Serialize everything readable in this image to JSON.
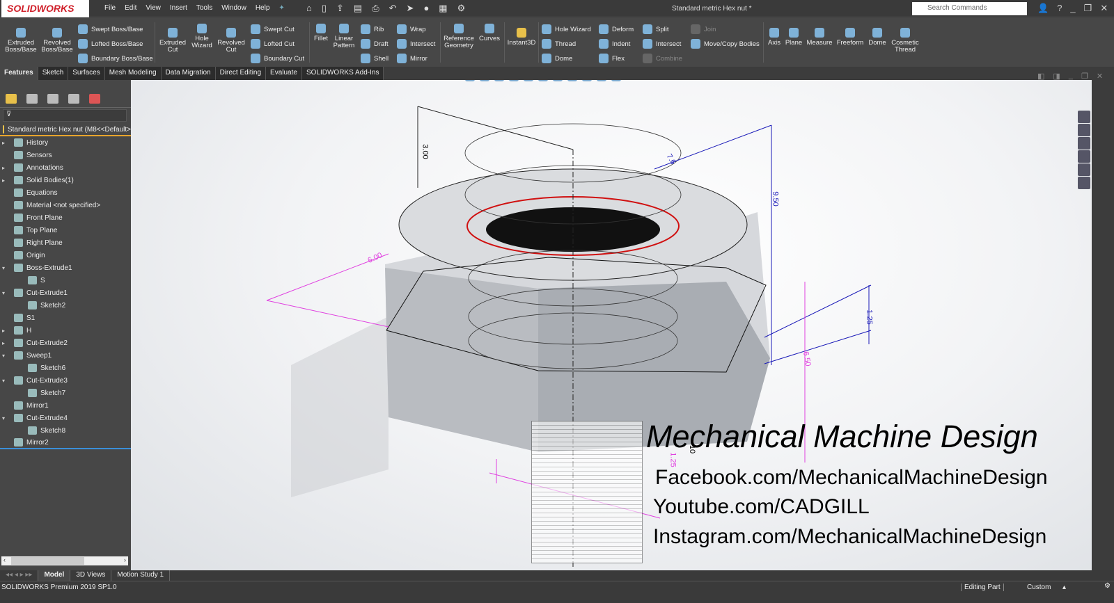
{
  "app": {
    "logo": "SOLIDWORKS",
    "title": "Standard metric Hex nut *",
    "search_placeholder": "Search Commands"
  },
  "menu": [
    "File",
    "Edit",
    "View",
    "Insert",
    "Tools",
    "Window",
    "Help"
  ],
  "ribbon": {
    "extruded_boss": "Extruded Boss/Base",
    "revolved_boss": "Revolved Boss/Base",
    "swept_boss": "Swept Boss/Base",
    "lofted_boss": "Lofted Boss/Base",
    "boundary_boss": "Boundary Boss/Base",
    "extruded_cut": "Extruded Cut",
    "hole_wizard": "Hole Wizard",
    "revolved_cut": "Revolved Cut",
    "swept_cut": "Swept Cut",
    "lofted_cut": "Lofted Cut",
    "boundary_cut": "Boundary Cut",
    "fillet": "Fillet",
    "linear_pattern": "Linear Pattern",
    "rib": "Rib",
    "draft": "Draft",
    "shell": "Shell",
    "wrap": "Wrap",
    "intersect": "Intersect",
    "mirror": "Mirror",
    "reference_geometry": "Reference Geometry",
    "curves": "Curves",
    "instant3d": "Instant3D",
    "hole_wizard2": "Hole Wizard",
    "thread": "Thread",
    "dome": "Dome",
    "deform": "Deform",
    "indent": "Indent",
    "flex": "Flex",
    "split": "Split",
    "intersect2": "Intersect",
    "combine": "Combine",
    "join": "Join",
    "move_copy": "Move/Copy Bodies",
    "axis": "Axis",
    "plane": "Plane",
    "measure": "Measure",
    "freeform": "Freeform",
    "dome2": "Dome",
    "cosmetic_thread": "Cosmetic Thread"
  },
  "tabs": [
    "Features",
    "Sketch",
    "Surfaces",
    "Mesh Modeling",
    "Data Migration",
    "Direct Editing",
    "Evaluate",
    "SOLIDWORKS Add-Ins"
  ],
  "tree": {
    "root": "Standard metric Hex nut  (M8<<Default>",
    "items": [
      {
        "label": "History",
        "arrow": "▸",
        "indent": 0
      },
      {
        "label": "Sensors",
        "arrow": "",
        "indent": 0
      },
      {
        "label": "Annotations",
        "arrow": "▸",
        "indent": 0
      },
      {
        "label": "Solid Bodies(1)",
        "arrow": "▸",
        "indent": 0
      },
      {
        "label": "Equations",
        "arrow": "",
        "indent": 0
      },
      {
        "label": "Material <not specified>",
        "arrow": "",
        "indent": 0
      },
      {
        "label": "Front Plane",
        "arrow": "",
        "indent": 0
      },
      {
        "label": "Top Plane",
        "arrow": "",
        "indent": 0
      },
      {
        "label": "Right Plane",
        "arrow": "",
        "indent": 0
      },
      {
        "label": "Origin",
        "arrow": "",
        "indent": 0
      },
      {
        "label": "Boss-Extrude1",
        "arrow": "▾",
        "indent": 0
      },
      {
        "label": "S",
        "arrow": "",
        "indent": 1
      },
      {
        "label": "Cut-Extrude1",
        "arrow": "▾",
        "indent": 0
      },
      {
        "label": "Sketch2",
        "arrow": "",
        "indent": 1
      },
      {
        "label": "S1",
        "arrow": "",
        "indent": 0
      },
      {
        "label": "H",
        "arrow": "▸",
        "indent": 0
      },
      {
        "label": "Cut-Extrude2",
        "arrow": "▸",
        "indent": 0
      },
      {
        "label": "Sweep1",
        "arrow": "▾",
        "indent": 0
      },
      {
        "label": "Sketch6",
        "arrow": "",
        "indent": 1
      },
      {
        "label": "Cut-Extrude3",
        "arrow": "▾",
        "indent": 0
      },
      {
        "label": "Sketch7",
        "arrow": "",
        "indent": 1
      },
      {
        "label": "Mirror1",
        "arrow": "",
        "indent": 0
      },
      {
        "label": "Cut-Extrude4",
        "arrow": "▾",
        "indent": 0
      },
      {
        "label": "Sketch8",
        "arrow": "",
        "indent": 1
      },
      {
        "label": "Mirror2",
        "arrow": "",
        "indent": 0
      }
    ]
  },
  "dimensions": {
    "d1": "3.00",
    "d2": "7.6",
    "d3": "9.50",
    "d4": "1.25",
    "d5": "6.50",
    "d6": "1.25",
    "d7": "10",
    "d8": "6.00"
  },
  "overlay": {
    "title": "Mechanical Machine Design",
    "facebook": "Facebook.com/MechanicalMachineDesign",
    "youtube": "Youtube.com/CADGILL",
    "instagram": "Instagram.com/MechanicalMachineDesign"
  },
  "bottom_tabs": [
    "Model",
    "3D Views",
    "Motion Study 1"
  ],
  "status": {
    "version": "SOLIDWORKS Premium 2019 SP1.0",
    "mode": "Editing Part",
    "units": "Custom"
  },
  "colors": {
    "accent": "#e8a52c",
    "dim_blue": "#1a1ab8",
    "dim_magenta": "#e040e0",
    "sketch_red": "#d01010"
  }
}
